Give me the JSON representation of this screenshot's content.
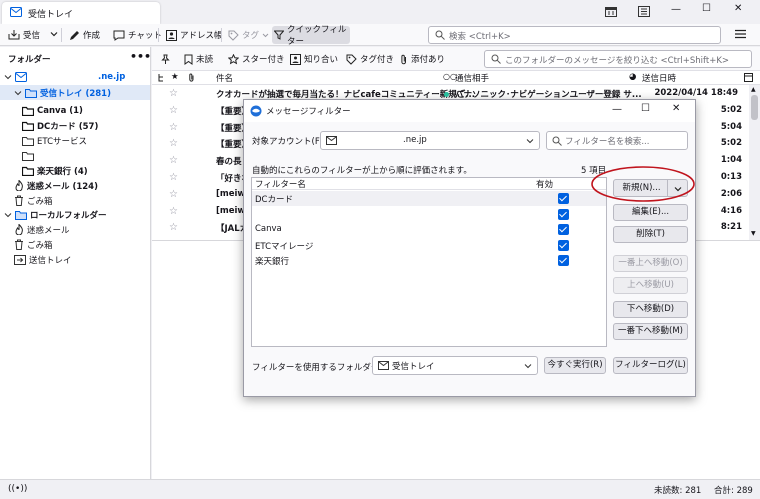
{
  "tab": {
    "title": "受信トレイ"
  },
  "window": {
    "minimize": "—",
    "maximize": "☐",
    "close": "✕"
  },
  "toolbar": {
    "get_mail": "受信",
    "write": "作成",
    "chat": "チャット",
    "address_book": "アドレス帳",
    "tag": "タグ",
    "quick_filter": "クイックフィルター",
    "search_placeholder": "検索 <Ctrl+K>"
  },
  "folder_pane": {
    "header": "フォルダー",
    "account": ".ne.jp",
    "items": [
      {
        "label": "受信トレイ (281)",
        "indent": 1
      },
      {
        "label": "Canva (1)",
        "indent": 2
      },
      {
        "label": "DCカード (57)",
        "indent": 2
      },
      {
        "label": "ETCサービス",
        "indent": 2
      },
      {
        "label": "",
        "indent": 2
      },
      {
        "label": "楽天銀行 (4)",
        "indent": 2
      },
      {
        "label": "迷惑メール (124)",
        "indent": 1
      },
      {
        "label": "ごみ箱",
        "indent": 1
      },
      {
        "label": "ローカルフォルダー",
        "indent": 0
      },
      {
        "label": "迷惑メール",
        "indent": 1
      },
      {
        "label": "ごみ箱",
        "indent": 1
      },
      {
        "label": "送信トレイ",
        "indent": 1
      }
    ]
  },
  "quick_filter_bar": {
    "unread": "未読",
    "starred": "スター付き",
    "contact": "知り合い",
    "tagged": "タグ付き",
    "attachment": "添付あり",
    "filter_placeholder": "このフォルダーのメッセージを絞り込む <Ctrl+Shift+K>"
  },
  "message_list": {
    "columns": {
      "subject": "件名",
      "correspondent": "通信相手",
      "date": "送信日時"
    },
    "rows": [
      {
        "subject": "クオカードが抽選で毎月当たる！ナビcafeコミュニティー新規ご...",
        "from": "パナソニック･ナビゲーションユーザー登録 サ...",
        "date": "2022/04/14 18:49"
      },
      {
        "subject": "【重要】",
        "from": "",
        "date": "5:02"
      },
      {
        "subject": "【重要】",
        "from": "",
        "date": "5:04"
      },
      {
        "subject": "【重要】",
        "from": "",
        "date": "5:02"
      },
      {
        "subject": "春の長",
        "from": "",
        "date": "1:04"
      },
      {
        "subject": "「好きな",
        "from": "",
        "date": "0:13"
      },
      {
        "subject": "[meiwa",
        "from": "",
        "date": "2:06"
      },
      {
        "subject": "[meiwa",
        "from": "",
        "date": "4:16"
      },
      {
        "subject": "【JALカー",
        "from": "",
        "date": "8:21"
      }
    ]
  },
  "dialog": {
    "title": "メッセージフィルター",
    "account_label": "対象アカウント(F):",
    "account_value": ".ne.jp",
    "search_placeholder": "フィルター名を検索...",
    "description": "自動的にこれらのフィルターが上から順に評価されます。",
    "count": "5 項目",
    "col_name": "フィルター名",
    "col_enabled": "有効",
    "filters": [
      {
        "name": "DCカード",
        "enabled": true
      },
      {
        "name": "",
        "enabled": true
      },
      {
        "name": "Canva",
        "enabled": true
      },
      {
        "name": "ETCマイレージ",
        "enabled": true
      },
      {
        "name": "楽天銀行",
        "enabled": true
      }
    ],
    "buttons": {
      "new": "新規(N)...",
      "edit": "編集(E)...",
      "delete": "削除(T)",
      "move_top": "一番上へ移動(O)",
      "move_up": "上へ移動(U)",
      "move_down": "下へ移動(D)",
      "move_bottom": "一番下へ移動(M)",
      "run_now": "今すぐ実行(R)",
      "filter_log": "フィルターログ(L)"
    },
    "folder_label": "フィルターを使用するフォルダー(C):",
    "folder_value": "受信トレイ"
  },
  "status": {
    "unread": "未読数: 281",
    "total": "合計: 289"
  },
  "colors": {
    "accent": "#0061e0",
    "highlight_ring": "#c0141d",
    "selected": "#e0e9f7"
  }
}
